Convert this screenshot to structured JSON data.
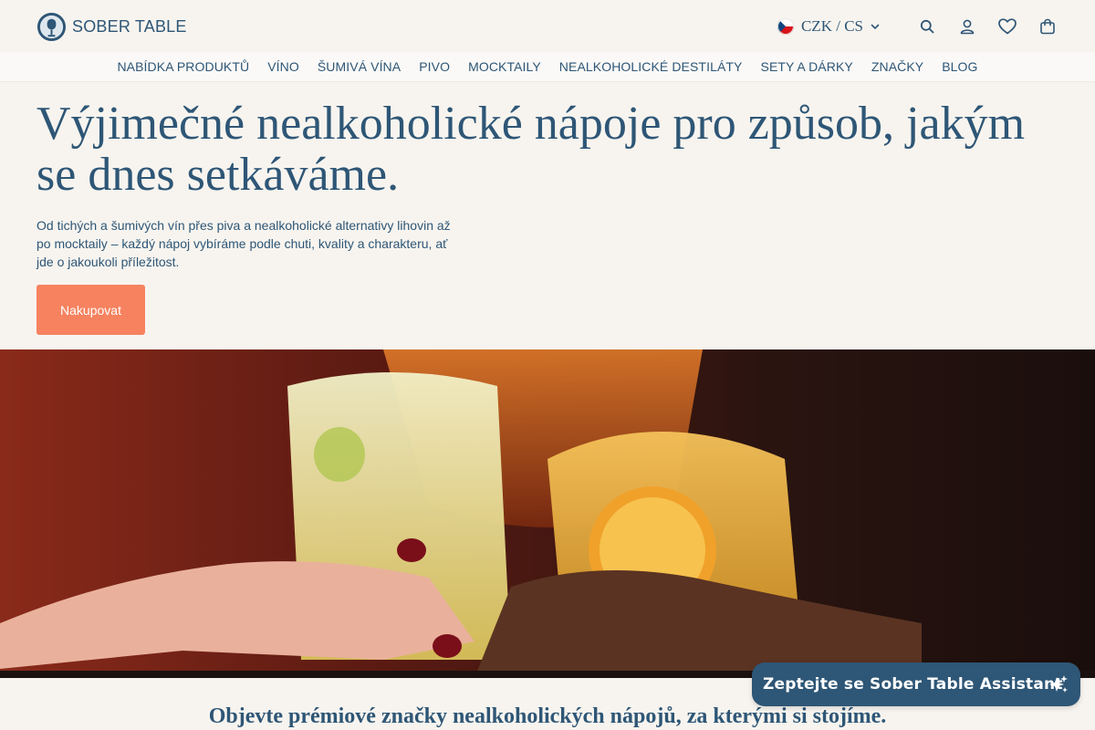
{
  "brand": {
    "name": "SOBER TABLE"
  },
  "header": {
    "locale": "CZK / CS",
    "icons": [
      "search-icon",
      "account-icon",
      "wishlist-icon",
      "cart-icon"
    ]
  },
  "nav": {
    "items": [
      "NABÍDKA PRODUKTŮ",
      "VÍNO",
      "ŠUMIVÁ VÍNA",
      "PIVO",
      "MOCKTAILY",
      "NEALKOHOLICKÉ DESTILÁTY",
      "SETY A DÁRKY",
      "ZNAČKY",
      "BLOG"
    ]
  },
  "hero": {
    "title": "Výjimečné nealkoholické nápoje pro způsob, jakým se dnes setkáváme.",
    "subtitle": "Od tichých a šumivých vín přes piva a nealkoholické alternativy lihovin až po mocktaily – každý nápoj vybíráme podle chuti, kvality a charakteru, ať jde o jakoukoli příležitost.",
    "cta_label": "Nakupovat"
  },
  "brands": {
    "heading": "Objevte prémiové značky nealkoholických nápojů, za kterými si stojíme."
  },
  "assistant": {
    "label": "Zeptejte se Sober Table Assistant"
  },
  "colors": {
    "primary": "#2e5676",
    "accent": "#f6825f",
    "background": "#f7f4ef"
  }
}
